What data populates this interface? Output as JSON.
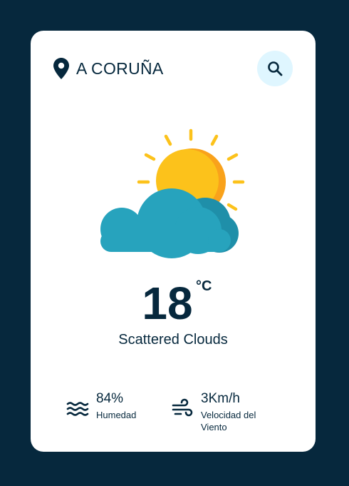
{
  "location": {
    "city": "A CORUÑA",
    "icon": "location-pin-icon"
  },
  "search": {
    "icon": "search-icon"
  },
  "weather": {
    "icon": "sun-behind-cloud-icon",
    "temperature": "18",
    "unit": "°C",
    "description": "Scattered Clouds"
  },
  "stats": {
    "humidity": {
      "value": "84%",
      "label": "Humedad",
      "icon": "water-waves-icon"
    },
    "wind": {
      "value": "3Km/h",
      "label": "Velocidad del Viento",
      "icon": "wind-icon"
    }
  },
  "colors": {
    "background": "#06283d",
    "card": "#ffffff",
    "text": "#06283d",
    "search_button": "#dff6ff",
    "sun": "#fcc21b",
    "cloud": "#27a3bd"
  }
}
